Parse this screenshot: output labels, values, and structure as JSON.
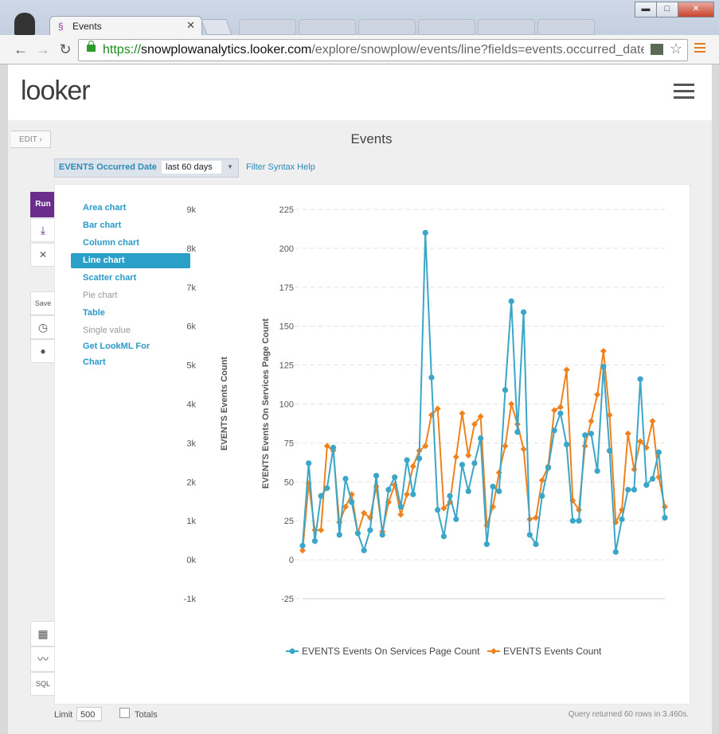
{
  "browser": {
    "tab_title": "Events",
    "tab_close": "✕",
    "url_scheme": "https://",
    "url_host": "snowplowanalytics.looker.com",
    "url_path": "/explore/snowplow/events/line?fields=events.occurred_date,",
    "window_minimize": "▬",
    "window_maximize": "□",
    "window_close": "✕"
  },
  "header": {
    "logo_text": "looker"
  },
  "toolbar": {
    "edit_label": "EDIT ›"
  },
  "page": {
    "title": "Events"
  },
  "filter": {
    "label": "EVENTS Occurred Date",
    "value": "last 60 days",
    "help_link": "Filter Syntax Help"
  },
  "left_toolbar": {
    "run_label": "Run",
    "save_label": "Save",
    "sql_label": "SQL"
  },
  "visualizations": [
    {
      "label": "Area chart",
      "enabled": true
    },
    {
      "label": "Bar chart",
      "enabled": true
    },
    {
      "label": "Column chart",
      "enabled": true
    },
    {
      "label": "Line chart",
      "enabled": true,
      "selected": true
    },
    {
      "label": "Scatter chart",
      "enabled": true
    },
    {
      "label": "Pie chart",
      "enabled": false
    },
    {
      "label": "Table",
      "enabled": true
    },
    {
      "label": "Single value",
      "enabled": false
    },
    {
      "label": "Get LookML For",
      "enabled": true
    },
    {
      "label": "Chart",
      "enabled": true
    }
  ],
  "footer": {
    "limit_label": "Limit",
    "limit_value": "500",
    "totals_label": "Totals",
    "status": "Query returned 60 rows in 3.460s."
  },
  "colors": {
    "series_blue": "#3aa6c8",
    "series_orange": "#f0821e",
    "accent_purple": "#6a2d8b"
  },
  "chart_data": {
    "type": "line",
    "left_axis_label": "EVENTS Events Count",
    "right_axis_label": "EVENTS Events On Services Page Count",
    "left_ticks": [
      "9k",
      "8k",
      "7k",
      "6k",
      "5k",
      "4k",
      "3k",
      "2k",
      "1k",
      "0k",
      "-1k"
    ],
    "right_ticks": [
      "225",
      "200",
      "175",
      "150",
      "125",
      "100",
      "75",
      "50",
      "25",
      "0",
      "-25"
    ],
    "ylim": [
      -25,
      225
    ],
    "legend_position": "bottom",
    "series": [
      {
        "name": "EVENTS Events On Services Page Count",
        "values": [
          9,
          62,
          12,
          41,
          46,
          72,
          16,
          52,
          37,
          17,
          6,
          19,
          54,
          16,
          45,
          53,
          34,
          64,
          42,
          65,
          210,
          117,
          32,
          15,
          41,
          26,
          61,
          44,
          62,
          78,
          10,
          47,
          44,
          109,
          166,
          82,
          159,
          16,
          10,
          41,
          59,
          83,
          94,
          74,
          25,
          25,
          80,
          81,
          57,
          124,
          70,
          5,
          26,
          45,
          45,
          116,
          48,
          52,
          69,
          27
        ]
      },
      {
        "name": "EVENTS Events Count",
        "values": [
          6,
          49,
          19,
          19,
          73,
          70,
          24,
          34,
          42,
          17,
          30,
          27,
          47,
          18,
          37,
          48,
          29,
          42,
          60,
          70,
          73,
          93,
          97,
          33,
          37,
          66,
          94,
          67,
          87,
          92,
          22,
          34,
          56,
          73,
          100,
          87,
          71,
          26,
          27,
          51,
          60,
          96,
          98,
          122,
          38,
          32,
          73,
          89,
          106,
          134,
          93,
          24,
          32,
          81,
          58,
          76,
          72,
          89,
          53,
          34
        ]
      }
    ]
  }
}
